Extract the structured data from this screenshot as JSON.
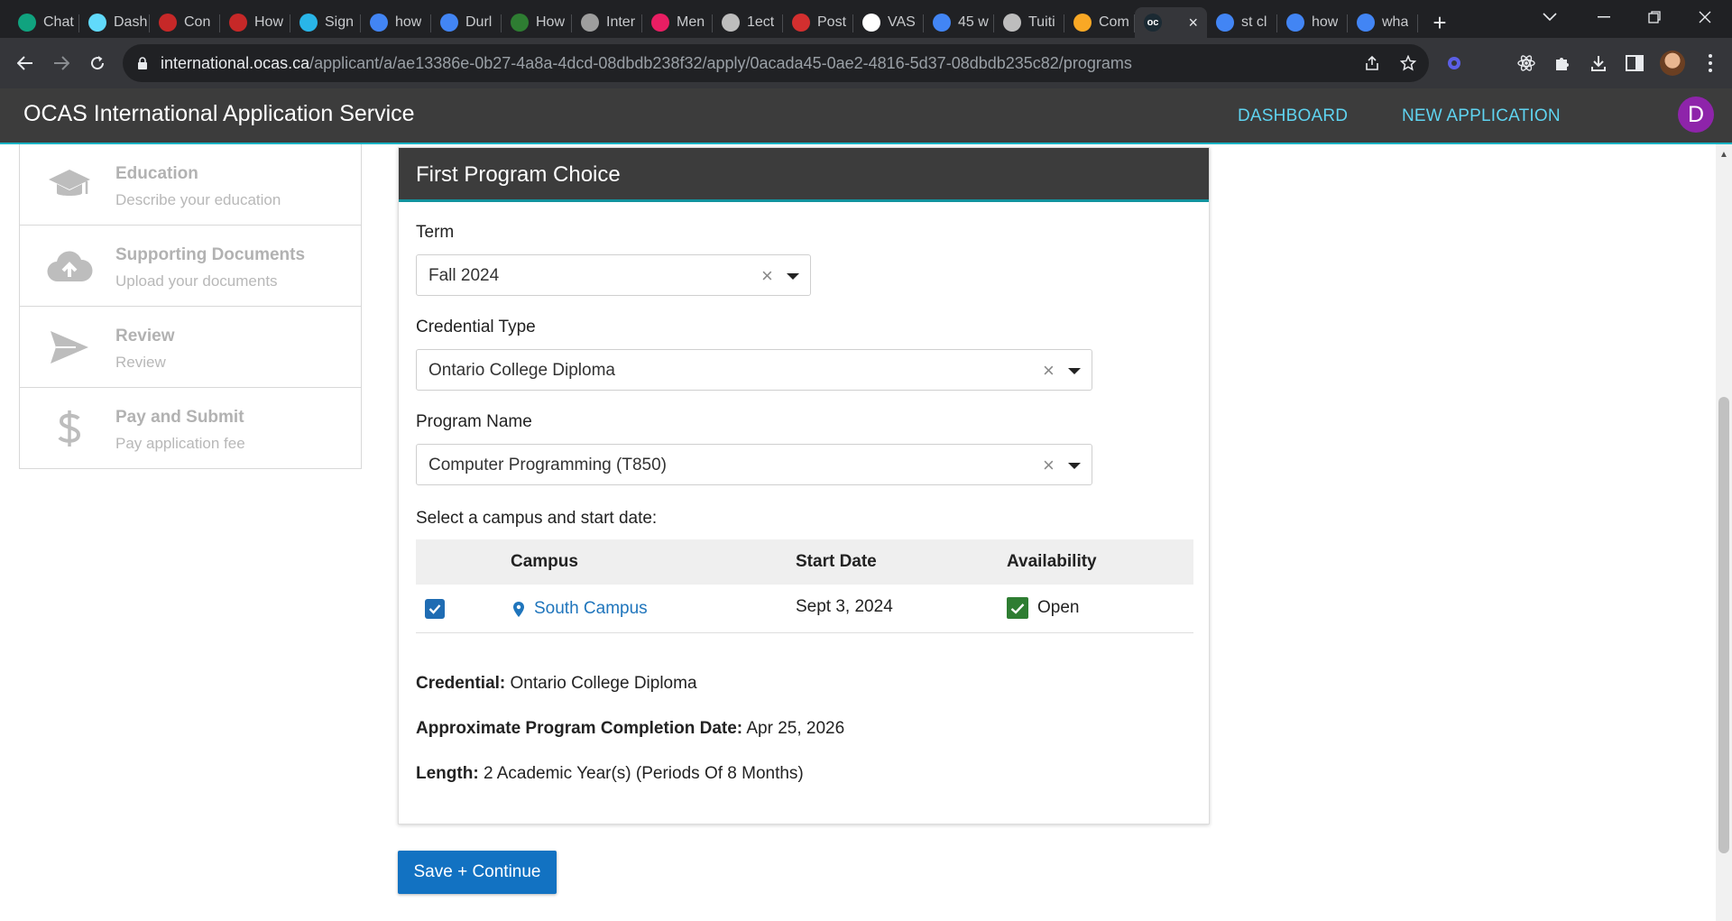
{
  "browser": {
    "tabs": [
      {
        "label": "Chat",
        "icon": "chatgpt-icon",
        "color": "#10a37f"
      },
      {
        "label": "Dash",
        "icon": "react-icon",
        "color": "#61dafb"
      },
      {
        "label": "Con",
        "icon": "mask-icon",
        "color": "#c62828"
      },
      {
        "label": "How",
        "icon": "mask-icon",
        "color": "#c62828"
      },
      {
        "label": "Sign",
        "icon": "snowflake-icon",
        "color": "#29b5e8"
      },
      {
        "label": "how",
        "icon": "google-icon",
        "color": "#4285f4"
      },
      {
        "label": "Durl",
        "icon": "google-icon",
        "color": "#4285f4"
      },
      {
        "label": "How",
        "icon": "flag-icon",
        "color": "#2e7d32"
      },
      {
        "label": "Inter",
        "icon": "page-icon",
        "color": "#9e9e9e"
      },
      {
        "label": "Men",
        "icon": "grid-icon",
        "color": "#e91e63"
      },
      {
        "label": "1ect",
        "icon": "globe-icon",
        "color": "#bdbdbd"
      },
      {
        "label": "Post",
        "icon": "star-icon",
        "color": "#d32f2f"
      },
      {
        "label": "VAS",
        "icon": "letter-a-icon",
        "color": "#ffffff"
      },
      {
        "label": "45 w",
        "icon": "google-icon",
        "color": "#4285f4"
      },
      {
        "label": "Tuiti",
        "icon": "globe-icon",
        "color": "#bdbdbd"
      },
      {
        "label": "Com",
        "icon": "bird-icon",
        "color": "#f9a825"
      },
      {
        "label": "",
        "icon": "ocas-icon",
        "color": "#35363a",
        "active": true
      },
      {
        "label": "st cl",
        "icon": "google-icon",
        "color": "#4285f4"
      },
      {
        "label": "how",
        "icon": "google-icon",
        "color": "#4285f4"
      },
      {
        "label": "wha",
        "icon": "google-icon",
        "color": "#4285f4"
      }
    ],
    "active_tab_favicon_text": "oc",
    "url_host": "international.ocas.ca",
    "url_path": "/applicant/a/ae13386e-0b27-4a8a-4dcd-08dbdb238f32/apply/0acada45-0ae2-4816-5d37-08dbdb235c82/programs"
  },
  "app": {
    "title": "OCAS International Application Service",
    "nav": {
      "dashboard": "DASHBOARD",
      "new_application": "NEW APPLICATION"
    },
    "avatar_letter": "D"
  },
  "steps": [
    {
      "title": "Education",
      "subtitle": "Describe your education",
      "icon": "graduation-cap-icon"
    },
    {
      "title": "Supporting Documents",
      "subtitle": "Upload your documents",
      "icon": "cloud-upload-icon"
    },
    {
      "title": "Review",
      "subtitle": "Review",
      "icon": "send-icon"
    },
    {
      "title": "Pay and Submit",
      "subtitle": "Pay application fee",
      "icon": "dollar-icon"
    }
  ],
  "program": {
    "card_title": "First Program Choice",
    "term_label": "Term",
    "term_value": "Fall 2024",
    "credential_type_label": "Credential Type",
    "credential_type_value": "Ontario College Diploma",
    "program_name_label": "Program Name",
    "program_name_value": "Computer Programming (T850)",
    "campus_prompt": "Select a campus and start date:",
    "table": {
      "headers": {
        "campus": "Campus",
        "start_date": "Start Date",
        "availability": "Availability"
      },
      "rows": [
        {
          "checked": true,
          "campus": "South Campus",
          "start_date": "Sept 3, 2024",
          "availability": "Open"
        }
      ]
    },
    "summary": {
      "credential_label": "Credential:",
      "credential_value": "Ontario College Diploma",
      "completion_label": "Approximate Program Completion Date:",
      "completion_value": "Apr 25, 2026",
      "length_label": "Length:",
      "length_value": "2 Academic Year(s) (Periods Of 8 Months)"
    }
  },
  "actions": {
    "save_continue": "Save + Continue"
  },
  "colors": {
    "accent": "#1272c2",
    "header_bg": "#3c3c3c",
    "nav_link": "#5fd3f0",
    "avatar": "#8e24aa",
    "available": "#2e7d32"
  }
}
